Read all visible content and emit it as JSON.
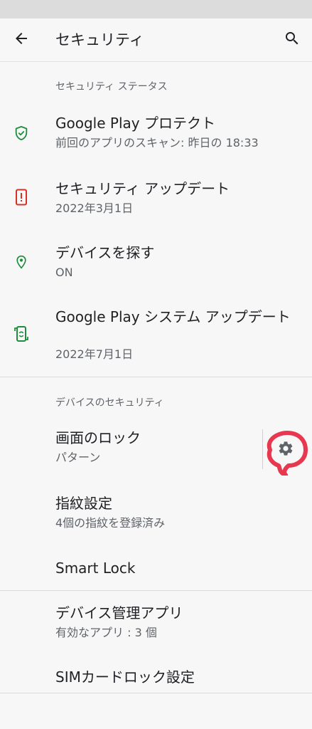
{
  "app_bar": {
    "title": "セキュリティ",
    "back_icon": "arrow-back-icon",
    "search_icon": "search-icon"
  },
  "sections": [
    {
      "header": "セキュリティ ステータス",
      "items": [
        {
          "title": "Google Play プロテクト",
          "subtitle": "前回のアプリのスキャン: 昨日の 18:33",
          "icon": "shield-check-icon",
          "icon_color": "#1e8e3e"
        },
        {
          "title": "セキュリティ アップデート",
          "subtitle": "2022年3月1日",
          "icon": "phone-alert-icon",
          "icon_color": "#d93025"
        },
        {
          "title": "デバイスを探す",
          "subtitle": "ON",
          "icon": "location-pin-icon",
          "icon_color": "#1e8e3e"
        },
        {
          "title": "Google Play システム アップデート",
          "subtitle": "2022年7月1日",
          "icon": "phone-sync-icon",
          "icon_color": "#1e8e3e"
        }
      ]
    },
    {
      "header": "デバイスのセキュリティ",
      "items": [
        {
          "title": "画面のロック",
          "subtitle": "パターン",
          "action_icon": "gear-icon",
          "highlight_color": "#e8384f"
        },
        {
          "title": "指紋設定",
          "subtitle": "4個の指紋を登録済み"
        },
        {
          "title": "Smart Lock"
        }
      ]
    },
    {
      "header": "",
      "items": [
        {
          "title": "デバイス管理アプリ",
          "subtitle": "有効なアプリ : 3 個"
        },
        {
          "title": "SIMカードロック設定"
        }
      ]
    }
  ]
}
